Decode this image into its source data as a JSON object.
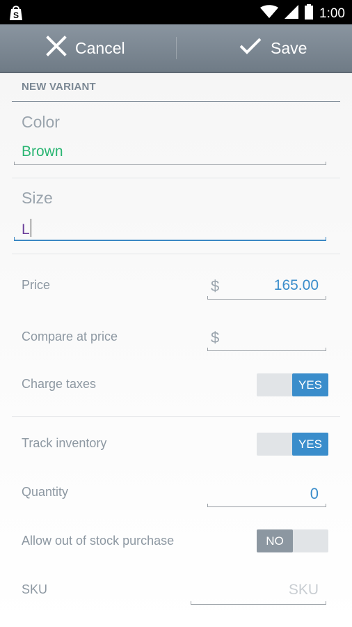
{
  "status_bar": {
    "time": "1:00",
    "icons": [
      "shopify-bag-icon",
      "wifi-icon",
      "signal-icon",
      "battery-icon"
    ]
  },
  "action_bar": {
    "cancel_label": "Cancel",
    "save_label": "Save"
  },
  "section": {
    "title": "NEW VARIANT"
  },
  "fields": {
    "color": {
      "label": "Color",
      "value": "Brown",
      "value_color": "#2bb673"
    },
    "size": {
      "label": "Size",
      "value": "L",
      "value_color": "#6a3d9a"
    }
  },
  "price": {
    "label": "Price",
    "currency": "$",
    "value": "165.00"
  },
  "compare_at_price": {
    "label": "Compare at price",
    "currency": "$",
    "value": ""
  },
  "charge_taxes": {
    "label": "Charge taxes",
    "state": "YES"
  },
  "track_inventory": {
    "label": "Track inventory",
    "state": "YES"
  },
  "quantity": {
    "label": "Quantity",
    "value": "0"
  },
  "allow_out_of_stock": {
    "label": "Allow out of stock purchase",
    "state": "NO"
  },
  "sku": {
    "label": "SKU",
    "placeholder": "SKU"
  },
  "colors": {
    "accent": "#3a8dcb",
    "action_bar": "#7b8792"
  }
}
